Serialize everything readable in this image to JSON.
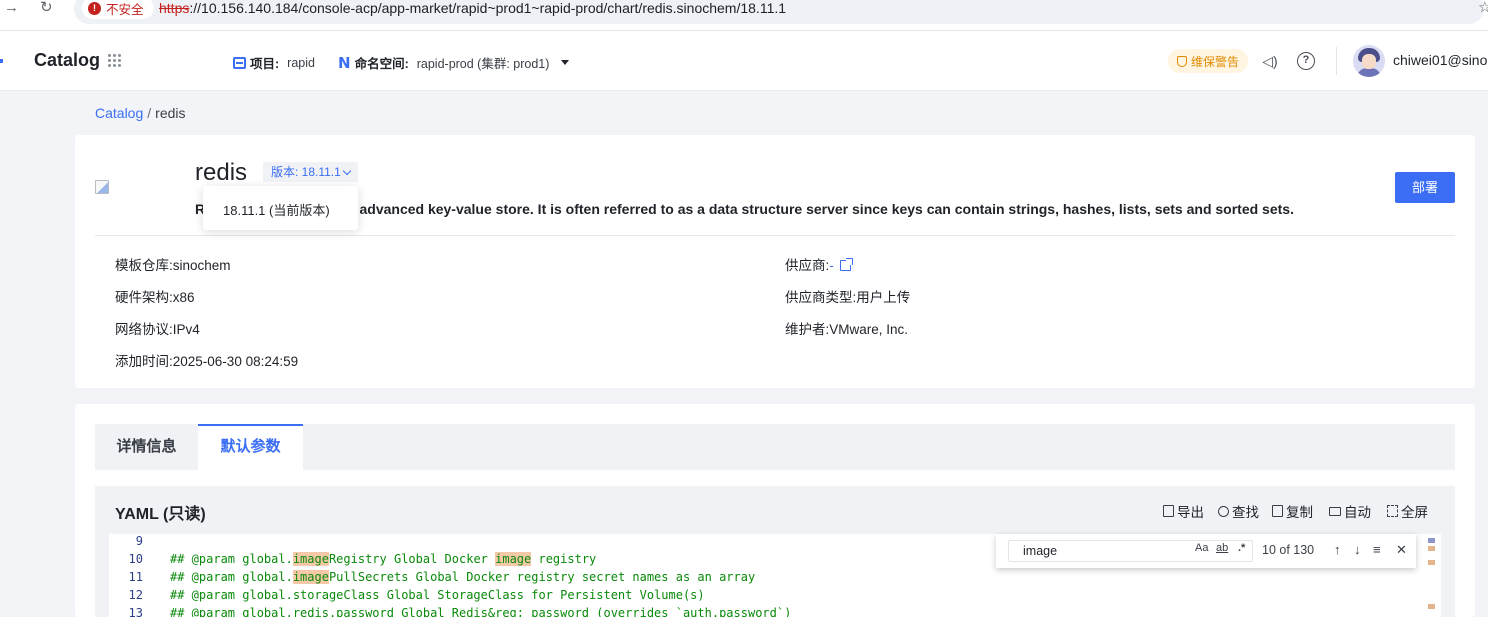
{
  "browser": {
    "insecure_label": "不安全",
    "url_scheme": "https",
    "url_rest": "://10.156.140.184/console-acp/app-market/rapid~prod1~rapid-prod/chart/redis.sinochem/18.11.1"
  },
  "header": {
    "app_title": "Catalog",
    "project_label": "项目:",
    "project_value": "rapid",
    "namespace_label": "命名空间:",
    "namespace_value": "rapid-prod (集群: prod1)",
    "warning_badge": "维保警告",
    "username": "chiwei01@sino"
  },
  "breadcrumb": {
    "root": "Catalog",
    "separator": "/",
    "current": "redis"
  },
  "app": {
    "name": "redis",
    "version_button": "版本: 18.11.1",
    "version_option": "18.11.1 (当前版本)",
    "description_prefix": "R",
    "description": "ce, advanced key-value store. It is often referred to as a data structure server since keys can contain strings, hashes, lists, sets and sorted sets.",
    "deploy_button": "部署",
    "details_left": [
      {
        "label": "模板仓库:",
        "value": "sinochem"
      },
      {
        "label": "硬件架构:",
        "value": "x86"
      },
      {
        "label": "网络协议:",
        "value": "IPv4"
      },
      {
        "label": "添加时间:",
        "value": "2025-06-30 08:24:59"
      }
    ],
    "details_right": [
      {
        "label": "供应商:",
        "value": "-"
      },
      {
        "label": "供应商类型:",
        "value": "用户上传"
      },
      {
        "label": "维护者:",
        "value": "VMware, Inc."
      }
    ]
  },
  "tabs": [
    {
      "label": "详情信息",
      "active": false
    },
    {
      "label": "默认参数",
      "active": true
    }
  ],
  "yaml": {
    "title": "YAML (只读)",
    "actions": [
      "导出",
      "查找",
      "复制",
      "自动",
      "全屏"
    ],
    "find": {
      "query": "image",
      "match_case": "Aa",
      "whole_word": "ab",
      "regex": ".*",
      "count": "10 of 130"
    },
    "lines": [
      {
        "n": "9",
        "segments": [
          ""
        ]
      },
      {
        "n": "10",
        "segments": [
          "## @param global.",
          "image",
          "Registry Global Docker ",
          "image",
          " registry"
        ]
      },
      {
        "n": "11",
        "segments": [
          "## @param global.",
          "image",
          "PullSecrets Global Docker registry secret names as an array"
        ]
      },
      {
        "n": "12",
        "segments": [
          "## @param global.storageClass Global StorageClass for Persistent Volume(s)"
        ]
      },
      {
        "n": "13",
        "segments": [
          "## @param global.redis.password Global Redis&reg; password (overrides `auth.password`)"
        ]
      }
    ]
  },
  "colors": {
    "accent": "#3b6ef5",
    "warning": "#e08a00",
    "insecure": "#c5221f",
    "code_comment": "#0a8a0a",
    "match_highlight": "#f5c8a8"
  }
}
